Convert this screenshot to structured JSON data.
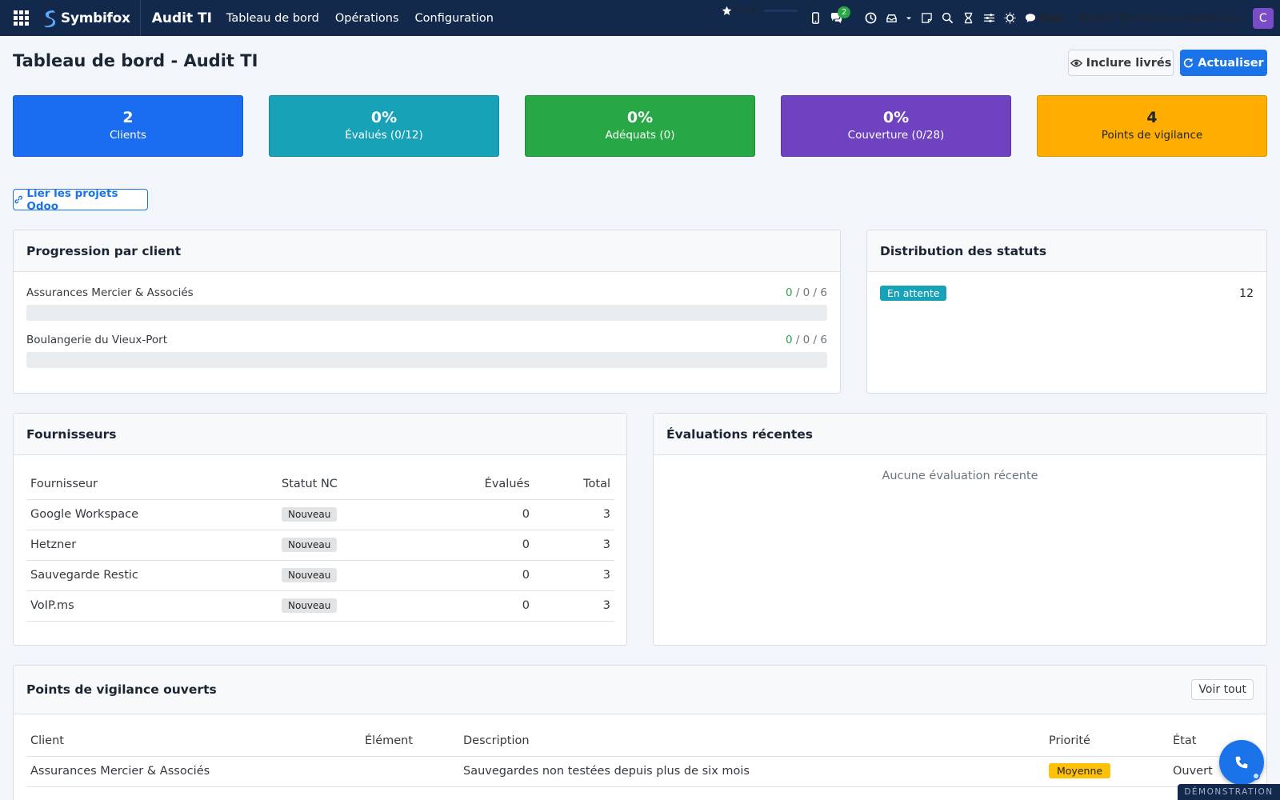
{
  "nav": {
    "brand": "Symbifox",
    "app_title": "Audit TI",
    "menu": [
      "Tableau de bord",
      "Opérations",
      "Configuration"
    ],
    "xp": "0 XP",
    "chat_count": "2",
    "user_label": "Gen",
    "company": "Boréal Services-conseils inc.",
    "avatar_letter": "C"
  },
  "page": {
    "title": "Tableau de bord - Audit TI",
    "include_delivered_label": "Inclure livrés",
    "refresh_label": "Actualiser"
  },
  "kpis": [
    {
      "value": "2",
      "label": "Clients",
      "color": "#1a6cf0"
    },
    {
      "value": "0%",
      "label": "Évalués (0/12)",
      "color": "#17a2b8"
    },
    {
      "value": "0%",
      "label": "Adéquats (0)",
      "color": "#28a745"
    },
    {
      "value": "0%",
      "label": "Couverture (0/28)",
      "color": "#6f42c1"
    },
    {
      "value": "4",
      "label": "Points de vigilance",
      "color": "#ffad00"
    }
  ],
  "link_odoo_label": "Lier les projets Odoo",
  "progress": {
    "title": "Progression par client",
    "rows": [
      {
        "client": "Assurances Mercier & Associés",
        "a": "0",
        "b": "0",
        "c": "6",
        "progress": 0
      },
      {
        "client": "Boulangerie du Vieux-Port",
        "a": "0",
        "b": "0",
        "c": "6",
        "progress": 0
      }
    ]
  },
  "status_dist": {
    "title": "Distribution des statuts",
    "rows": [
      {
        "label": "En attente",
        "count": "12"
      }
    ]
  },
  "suppliers": {
    "title": "Fournisseurs",
    "headers": [
      "Fournisseur",
      "Statut NC",
      "Évalués",
      "Total"
    ],
    "rows": [
      {
        "name": "Google Workspace",
        "status": "Nouveau",
        "evaluated": "0",
        "total": "3"
      },
      {
        "name": "Hetzner",
        "status": "Nouveau",
        "evaluated": "0",
        "total": "3"
      },
      {
        "name": "Sauvegarde Restic",
        "status": "Nouveau",
        "evaluated": "0",
        "total": "3"
      },
      {
        "name": "VoIP.ms",
        "status": "Nouveau",
        "evaluated": "0",
        "total": "3"
      }
    ]
  },
  "recent": {
    "title": "Évaluations récentes",
    "empty": "Aucune évaluation récente"
  },
  "vigilance": {
    "title": "Points de vigilance ouverts",
    "see_all": "Voir tout",
    "headers": [
      "Client",
      "Élément",
      "Description",
      "Priorité",
      "État"
    ],
    "rows": [
      {
        "client": "Assurances Mercier & Associés",
        "element": "",
        "description": "Sauvegardes non testées depuis plus de six mois",
        "priority": "Moyenne",
        "state": "Ouvert"
      }
    ]
  },
  "demo_label": "DÉMONSTRATION"
}
